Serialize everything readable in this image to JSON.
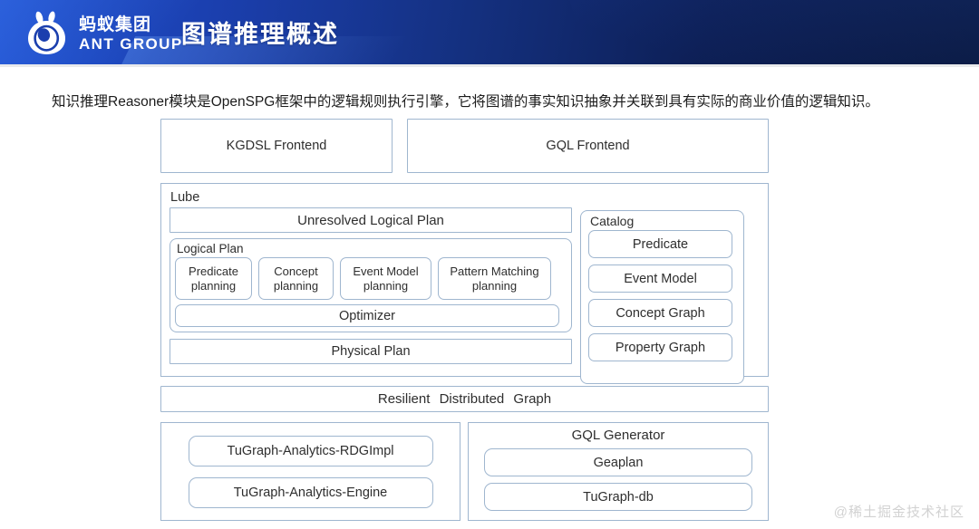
{
  "header": {
    "brand_cn": "蚂蚁集团",
    "brand_en": "ANT GROUP",
    "logo_icon": "ant-head-logo-icon",
    "title": "图谱推理概述",
    "gradient_from": "#1d4fd0",
    "gradient_to": "#081536"
  },
  "intro": {
    "paragraph": "知识推理Reasoner模块是OpenSPG框架中的逻辑规则执行引擎，它将图谱的事实知识抽象并关联到具有实际的商业价值的逻辑知识。"
  },
  "diagram": {
    "frontends": {
      "kgdsl": "KGDSL Frontend",
      "gql": "GQL Frontend"
    },
    "lube": {
      "label": "Lube",
      "unresolved_logical_plan": "Unresolved Logical Plan",
      "logical_plan": {
        "label": "Logical Plan",
        "planning_boxes": [
          {
            "line1": "Predicate",
            "line2": "planning"
          },
          {
            "line1": "Concept",
            "line2": "planning"
          },
          {
            "line1": "Event Model",
            "line2": "planning"
          },
          {
            "line1": "Pattern Matching",
            "line2": "planning"
          }
        ],
        "optimizer": "Optimizer"
      },
      "physical_plan": "Physical Plan"
    },
    "catalog": {
      "label": "Catalog",
      "items": [
        "Predicate",
        "Event Model",
        "Concept Graph",
        "Property Graph"
      ]
    },
    "resilient_distributed_graph": "Resilient  Distributed   Graph",
    "tugraph_panel": {
      "items": [
        "TuGraph-Analytics-RDGImpl",
        "TuGraph-Analytics-Engine"
      ]
    },
    "gql_generator": {
      "title": "GQL Generator",
      "items": [
        "Geaplan",
        "TuGraph-db"
      ]
    },
    "border_color": "#9fb6cf",
    "text_color": "#2e2e2e"
  },
  "watermark": {
    "text": "@稀土掘金技术社区"
  }
}
